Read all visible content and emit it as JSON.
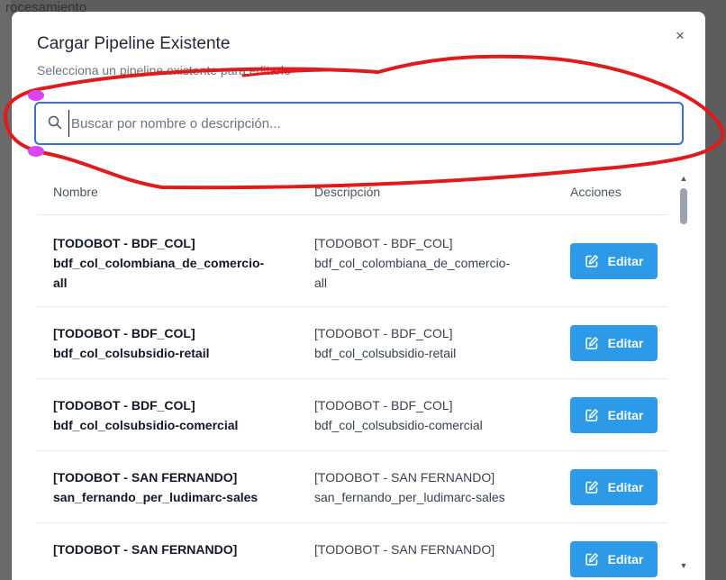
{
  "backdrop": {
    "text": "rocesamiento"
  },
  "modal": {
    "title": "Cargar Pipeline Existente",
    "subtitle": "Selecciona un pipeline existente para editarlo",
    "close_label": "×"
  },
  "search": {
    "placeholder": "Buscar por nombre o descripción...",
    "value": ""
  },
  "table": {
    "columns": [
      "Nombre",
      "Descripción",
      "Acciones"
    ],
    "rows": [
      {
        "name_line1": "[TODOBOT - BDF_COL]",
        "name_line2": "bdf_col_colombiana_de_comercio-",
        "name_line3": "all",
        "desc_line1": "[TODOBOT - BDF_COL]",
        "desc_line2": "bdf_col_colombiana_de_comercio-",
        "desc_line3": "all",
        "action": "Editar"
      },
      {
        "name_line1": "[TODOBOT - BDF_COL]",
        "name_line2": "bdf_col_colsubsidio-retail",
        "desc_line1": "[TODOBOT - BDF_COL]",
        "desc_line2": "bdf_col_colsubsidio-retail",
        "action": "Editar"
      },
      {
        "name_line1": "[TODOBOT - BDF_COL]",
        "name_line2": "bdf_col_colsubsidio-comercial",
        "desc_line1": "[TODOBOT - BDF_COL]",
        "desc_line2": "bdf_col_colsubsidio-comercial",
        "action": "Editar"
      },
      {
        "name_line1": "[TODOBOT - SAN FERNANDO]",
        "name_line2": "san_fernando_per_ludimarc-sales",
        "desc_line1": "[TODOBOT - SAN FERNANDO]",
        "desc_line2": "san_fernando_per_ludimarc-sales",
        "action": "Editar"
      },
      {
        "name_line1": "[TODOBOT - SAN FERNANDO]",
        "desc_line1": "[TODOBOT - SAN FERNANDO]",
        "action": "Editar"
      }
    ]
  },
  "colors": {
    "accent_button": "#2c9ae6",
    "search_border": "#3b6fd8",
    "annotation_stroke": "#e01b1b",
    "annotation_handle": "#d946ef"
  },
  "icons": {
    "close": "close-icon",
    "search": "search-icon",
    "edit": "edit-icon"
  }
}
